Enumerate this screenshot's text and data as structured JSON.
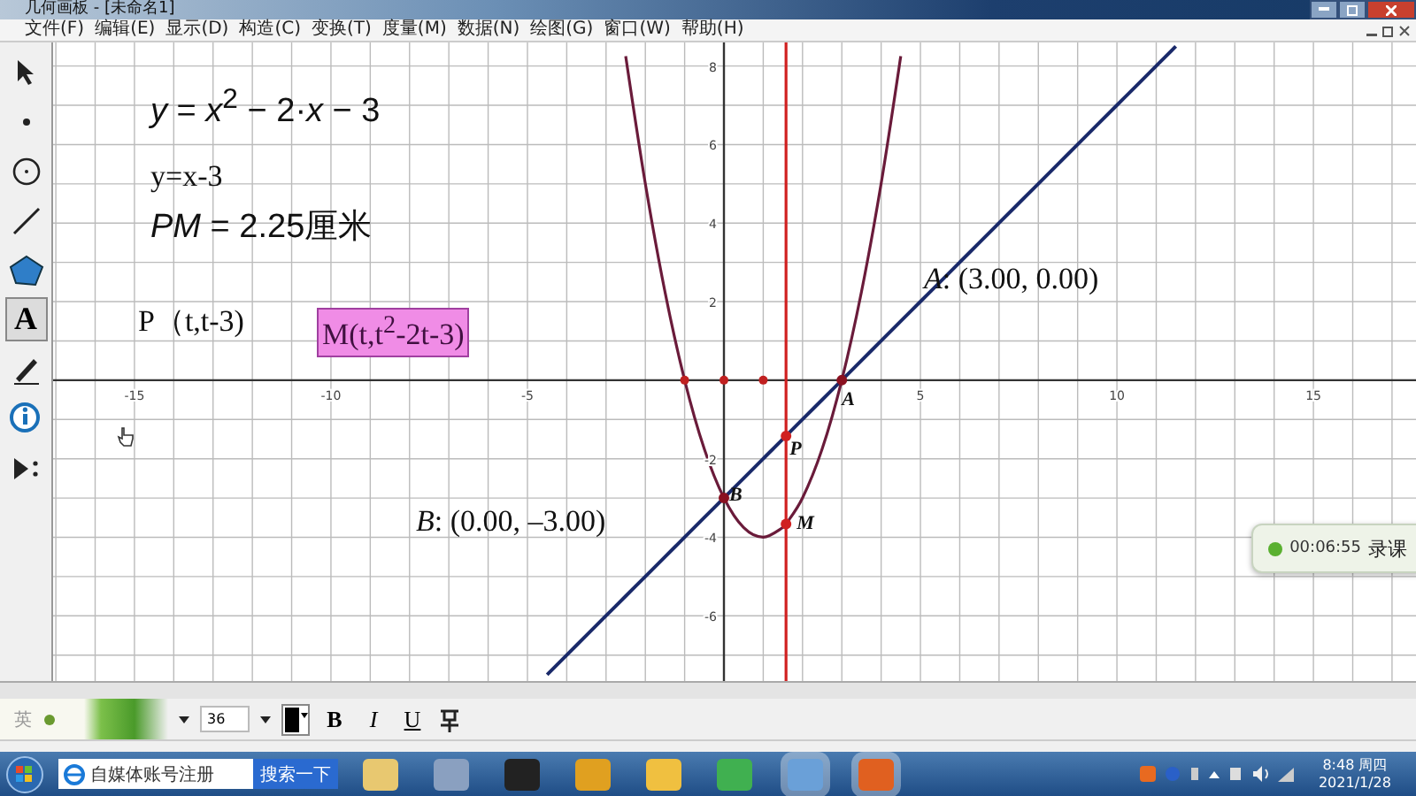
{
  "window": {
    "title": "几何画板 - [未命名1]"
  },
  "menu": [
    "文件(F)",
    "编辑(E)",
    "显示(D)",
    "构造(C)",
    "变换(T)",
    "度量(M)",
    "数据(N)",
    "绘图(G)",
    "窗口(W)",
    "帮助(H)"
  ],
  "tools": [
    {
      "selected": false
    },
    {
      "selected": false
    },
    {
      "selected": false
    },
    {
      "selected": false
    },
    {
      "selected": false
    },
    {
      "label": "A",
      "selected": true
    },
    {
      "selected": false
    },
    {
      "selected": false
    },
    {
      "selected": false
    }
  ],
  "sketch": {
    "measurement": "*PM* = 2.25厘米",
    "p_text": "P（t,t-3)",
    "m_text": {
      "text": "M(t,t$^{2}$-2t-3)",
      "selected": true
    },
    "chart_data": {
      "type": "line",
      "grid": true,
      "x": [
        -4.5,
        -4,
        -3.5,
        -3,
        -2.5,
        -2,
        -1.5,
        -1,
        -0.5,
        0,
        0.5,
        1,
        1.5,
        1.58,
        2,
        2.5,
        3,
        3.5,
        4,
        4.5,
        5,
        5.5,
        6,
        6.5,
        7,
        7.5,
        8,
        8.5,
        9,
        9.5,
        10,
        10.5,
        11,
        11.5
      ],
      "series": [
        {
          "name": "*y* = *x*$^{2}$ − 2·*x* − 3",
          "color": "#6a1b3a",
          "values": [
            null,
            null,
            null,
            null,
            8.25,
            5,
            2.25,
            0,
            -1.75,
            -3,
            -3.75,
            -4,
            -3.75,
            -3.66,
            -3,
            -1.75,
            0,
            2.25,
            5,
            8.25,
            null,
            null,
            null,
            null,
            null,
            null,
            null,
            null,
            null,
            null,
            null,
            null,
            null,
            null
          ]
        },
        {
          "name": "y=x-3",
          "color": "#1a2a6a",
          "values": [
            -7.5,
            -7,
            -6.5,
            -6,
            -5.5,
            -5,
            -4.5,
            -4,
            -3.5,
            -3,
            -2.5,
            -2,
            -1.5,
            -1.42,
            -1,
            -0.5,
            0,
            0.5,
            1,
            1.5,
            2,
            2.5,
            3,
            3.5,
            4,
            4.5,
            5,
            5.5,
            6,
            6.5,
            7,
            7.5,
            8,
            8.5
          ]
        },
        {
          "type": "scatter",
          "color": "#c02020",
          "values": [
            null,
            null,
            null,
            null,
            null,
            null,
            null,
            0,
            null,
            0,
            null,
            0,
            null,
            null,
            null,
            null,
            null,
            null,
            null,
            null,
            null,
            null,
            null,
            null,
            null,
            null,
            null,
            null,
            null,
            null,
            null,
            null,
            null,
            null
          ]
        },
        {
          "type": "scatter",
          "name": "A",
          "color": "#8a1020",
          "values": [
            null,
            null,
            null,
            null,
            null,
            null,
            null,
            null,
            null,
            null,
            null,
            null,
            null,
            null,
            null,
            null,
            0,
            null,
            null,
            null,
            null,
            null,
            null,
            null,
            null,
            null,
            null,
            null,
            null,
            null,
            null,
            null,
            null,
            null
          ]
        },
        {
          "type": "scatter",
          "name": "B",
          "color": "#8a1020",
          "values": [
            null,
            null,
            null,
            null,
            null,
            null,
            null,
            null,
            null,
            -3,
            null,
            null,
            null,
            null,
            null,
            null,
            null,
            null,
            null,
            null,
            null,
            null,
            null,
            null,
            null,
            null,
            null,
            null,
            null,
            null,
            null,
            null,
            null,
            null
          ]
        },
        {
          "type": "scatter",
          "name": "P",
          "color": "#d02020",
          "values": [
            null,
            null,
            null,
            null,
            null,
            null,
            null,
            null,
            null,
            null,
            null,
            null,
            null,
            -1.42,
            null,
            null,
            null,
            null,
            null,
            null,
            null,
            null,
            null,
            null,
            null,
            null,
            null,
            null,
            null,
            null,
            null,
            null,
            null,
            null
          ]
        },
        {
          "type": "scatter",
          "name": "M",
          "color": "#d02020",
          "values": [
            null,
            null,
            null,
            null,
            null,
            null,
            null,
            null,
            null,
            null,
            null,
            null,
            null,
            -3.66,
            null,
            null,
            null,
            null,
            null,
            null,
            null,
            null,
            null,
            null,
            null,
            null,
            null,
            null,
            null,
            null,
            null,
            null,
            null,
            null
          ]
        }
      ],
      "ref_lines": [
        {
          "axis": "x",
          "value": 1.58,
          "color": "#d02020"
        }
      ],
      "xlim": [
        -17.07,
        17.61
      ],
      "ylim": [
        -7.66,
        8.6
      ],
      "xticks": [
        -15,
        -10,
        -5,
        5,
        10,
        15
      ],
      "yticks": [
        8,
        6,
        4,
        2,
        -2,
        -4,
        -6
      ]
    },
    "coordinates": [
      "*A*: (3.00, 0.00)",
      "*B*: (0.00, –3.00)"
    ]
  },
  "recorder": {
    "time": "00:06:55",
    "label": "录课"
  },
  "font_bar": {
    "ime": "英",
    "size": "36",
    "bold": "B",
    "italic": "I",
    "underline": "U"
  },
  "taskbar": {
    "search_text": "自媒体账号注册",
    "search_button": "搜索一下",
    "time": "8:48 周四",
    "date": "2021/1/28"
  }
}
